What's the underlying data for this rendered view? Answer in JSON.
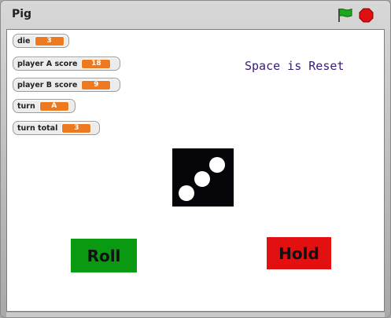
{
  "window": {
    "title": "Pig"
  },
  "controls": {
    "green_flag": "green-flag-icon",
    "stop": "stop-sign-icon",
    "flag_color": "#1ea61e",
    "stop_color": "#e01010"
  },
  "watchers": [
    {
      "label": "die",
      "value": "3"
    },
    {
      "label": "player A score",
      "value": "18"
    },
    {
      "label": "player B score",
      "value": "9"
    },
    {
      "label": "turn",
      "value": "A"
    },
    {
      "label": "turn total",
      "value": "3"
    }
  ],
  "stage": {
    "reset_hint": "Space is Reset",
    "die_face": 3,
    "roll_label": "Roll",
    "hold_label": "Hold",
    "roll_color": "#0a9a12",
    "hold_color": "#e21010"
  }
}
